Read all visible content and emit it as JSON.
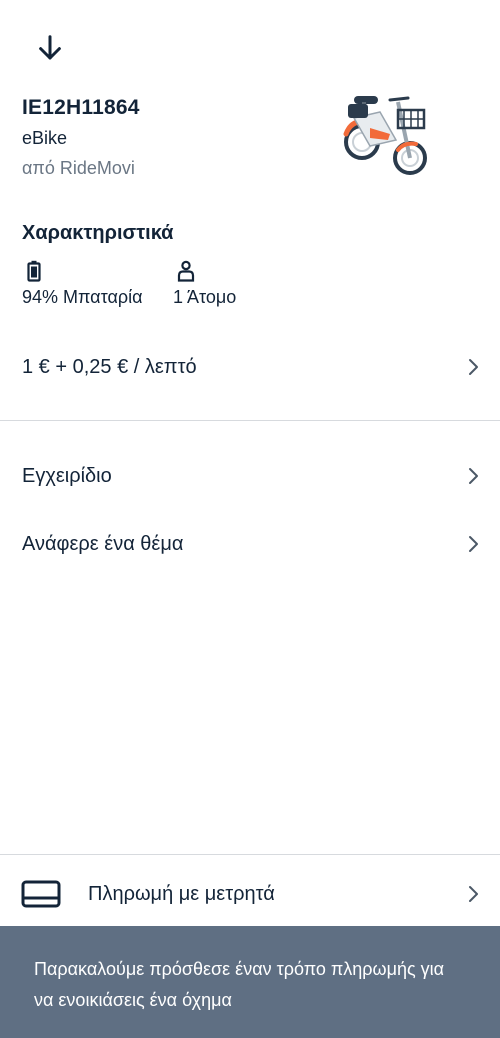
{
  "vehicle": {
    "id": "IE12H11864",
    "type": "eBike",
    "provider": "από RideMovi"
  },
  "features": {
    "heading": "Χαρακτηριστικά",
    "battery_label": "94% Μπαταρία",
    "battery_icon": "battery-icon",
    "seats_label": "1 Άτομο",
    "seats_icon": "person-icon"
  },
  "pricing": {
    "label": "1 € + 0,25 € / λεπτό"
  },
  "links": {
    "manual": "Εγχειρίδιο",
    "report": "Ανάφερε ένα θέμα"
  },
  "payment": {
    "label": "Πληρωμή με μετρητά",
    "icon": "credit-card-icon"
  },
  "notice": {
    "text": "Παρακαλούμε πρόσθεσε έναν τρόπο πληρωμής για να ενοικιάσεις ένα όχημα"
  },
  "colors": {
    "text_primary": "#132438",
    "text_secondary": "#6a7684",
    "notice_background": "#5f6f83",
    "divider": "#d7dade",
    "accent_orange": "#f26b3a"
  }
}
